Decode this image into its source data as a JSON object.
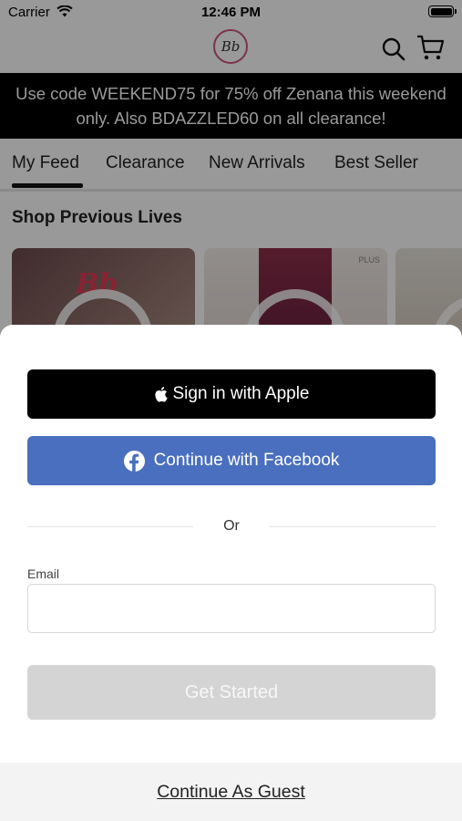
{
  "status_bar": {
    "carrier": "Carrier",
    "time": "12:46 PM"
  },
  "header": {
    "logo_text": "Bb",
    "icons": [
      "search-icon",
      "cart-icon"
    ]
  },
  "promo_banner": {
    "text": "Use code WEEKEND75 for 75% off Zenana this weekend only. Also BDAZZLED60 on all clearance!"
  },
  "tabs": [
    {
      "label": "My Feed",
      "active": true
    },
    {
      "label": "Clearance",
      "active": false
    },
    {
      "label": "New Arrivals",
      "active": false
    },
    {
      "label": "Best Seller",
      "active": false
    }
  ],
  "feed": {
    "section_title": "Shop Previous Lives",
    "cards": [
      {
        "mark": "Bb"
      },
      {
        "badge": "PLUS"
      },
      {}
    ]
  },
  "login_sheet": {
    "apple_button": "Sign in with Apple",
    "facebook_button": "Continue with Facebook",
    "divider_text": "Or",
    "email_label": "Email",
    "email_value": "",
    "email_placeholder": "",
    "submit_button": "Get Started",
    "guest_link": "Continue As Guest"
  },
  "colors": {
    "promo_bg": "#000000",
    "facebook_blue": "#4a6fbf",
    "apple_black": "#000000",
    "disabled_button": "#d4d4d4",
    "logo_ring": "#c9587a"
  }
}
